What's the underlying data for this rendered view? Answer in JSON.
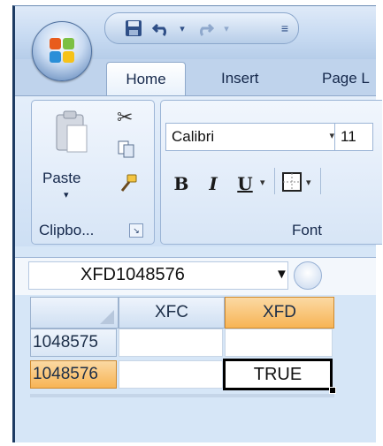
{
  "quick_access": {
    "save_icon": "save-icon",
    "undo_icon": "undo-icon",
    "redo_icon": "redo-icon",
    "customize_icon": "customize-qat-icon"
  },
  "tabs": [
    {
      "label": "Home"
    },
    {
      "label": "Insert"
    },
    {
      "label": "Page L"
    }
  ],
  "clipboard": {
    "paste_label": "Paste",
    "group_label": "Clipbo...",
    "cut_icon": "scissors-icon",
    "copy_icon": "copy-icon",
    "format_painter_icon": "format-painter-icon"
  },
  "font": {
    "font_name": "Calibri",
    "font_size": "11",
    "bold_label": "B",
    "italic_label": "I",
    "underline_label": "U",
    "group_label": "Font"
  },
  "name_box": {
    "value": "XFD1048576"
  },
  "sheet": {
    "columns": [
      "XFC",
      "XFD"
    ],
    "rows": [
      {
        "label": "1048575",
        "cells": [
          "",
          ""
        ]
      },
      {
        "label": "1048576",
        "cells": [
          "",
          "TRUE"
        ]
      }
    ]
  },
  "colors": {
    "selected_header": "#f7b455",
    "ribbon_blue": "#d6e6f7",
    "active_border": "#000000"
  }
}
